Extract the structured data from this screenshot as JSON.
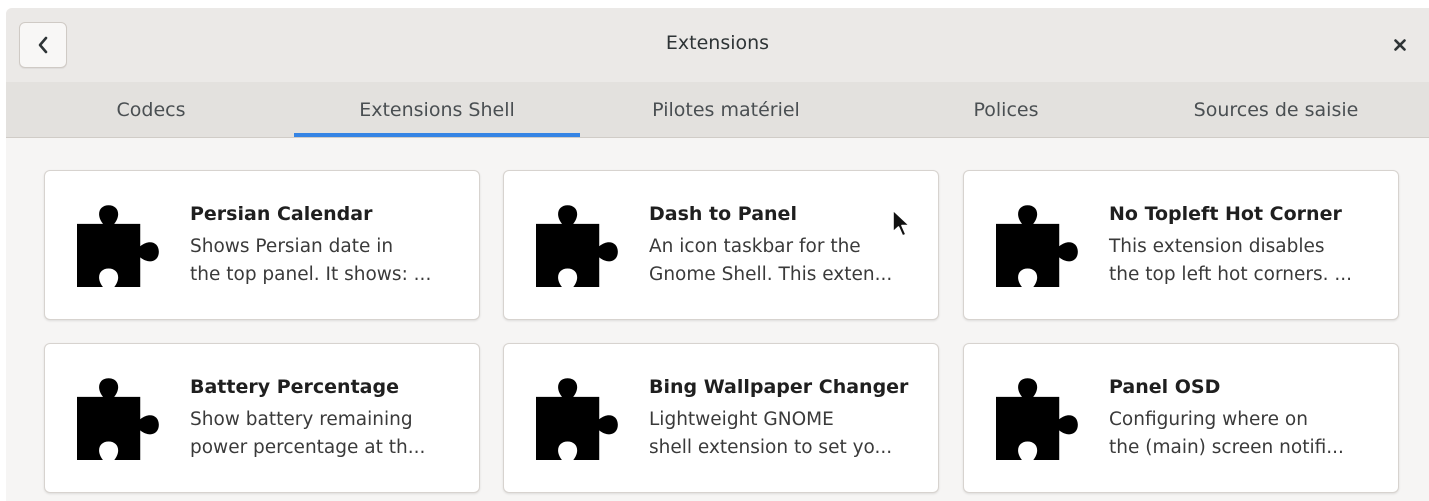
{
  "window": {
    "title": "Extensions"
  },
  "tabs": [
    {
      "label": "Codecs",
      "active": false
    },
    {
      "label": "Extensions Shell",
      "active": true
    },
    {
      "label": "Pilotes matériel",
      "active": false
    },
    {
      "label": "Polices",
      "active": false
    },
    {
      "label": "Sources de saisie",
      "active": false
    }
  ],
  "extensions": [
    {
      "name": "Persian Calendar",
      "description": "Shows Persian date in\nthe top panel.  It shows: ..."
    },
    {
      "name": "Dash to Panel",
      "description": "An icon taskbar for the\nGnome Shell. This exten..."
    },
    {
      "name": "No Topleft Hot Corner",
      "description": "This extension disables\nthe top left hot corners. ..."
    },
    {
      "name": "Battery Percentage",
      "description": "Show battery remaining\npower percentage at th..."
    },
    {
      "name": "Bing Wallpaper Changer",
      "description": "Lightweight GNOME\nshell extension to set yo..."
    },
    {
      "name": "Panel OSD",
      "description": "Configuring where on\nthe (main) screen notifi..."
    }
  ],
  "icons": {
    "back": "chevron-left-icon",
    "close": "close-icon",
    "extension": "puzzle-piece-icon"
  },
  "colors": {
    "accent": "#3584e4",
    "headerbar": "#ebe9e7",
    "tabbar": "#e3e1de"
  }
}
